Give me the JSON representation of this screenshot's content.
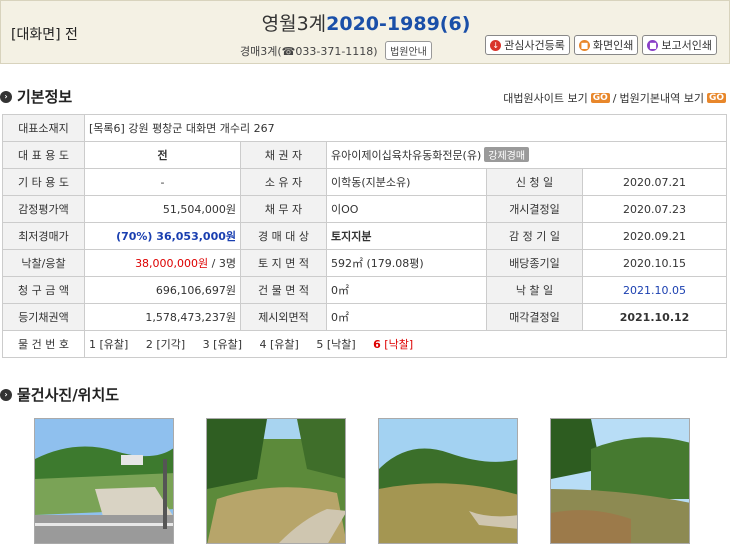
{
  "header": {
    "location": "[대화면] 전",
    "court": "영월3계",
    "case_no": "2020-1989(6)",
    "contact_prefix": "경매3계(☎",
    "phone": "033-371-1118)",
    "court_info_btn": "법원안내",
    "btn_interest": "관심사건등록",
    "btn_print_screen": "화면인쇄",
    "btn_print_report": "보고서인쇄"
  },
  "basic": {
    "title": "기본정보",
    "link_supreme": "대법원사이트 보기",
    "link_court": "법원기본내역 보기",
    "go": "GO",
    "sep": "/"
  },
  "rows": {
    "addr_label": "대표소재지",
    "addr_tag": "[목록6]",
    "addr_value": "강원 평창군 대화면 개수리 267",
    "use_label": "대 표 용 도",
    "use_value": "전",
    "creditor_label": "채 권 자",
    "creditor_value": "유아이제이십육차유동화전문(유)",
    "forced_tag": "강제경매",
    "other_use_label": "기 타 용 도",
    "other_use_value": "-",
    "owner_label": "소 유 자",
    "owner_value": "이학동(지분소유)",
    "apply_label": "신 청 일",
    "apply_value": "2020.07.21",
    "appraisal_label": "감정평가액",
    "appraisal_value": "51,504,000원",
    "debtor_label": "채 무 자",
    "debtor_value": "이OO",
    "start_label": "개시결정일",
    "start_value": "2020.07.23",
    "min_label": "최저경매가",
    "min_value": "(70%) 36,053,000원",
    "target_label": "경 매 대 상",
    "target_value": "토지지분",
    "appraisal_date_label": "감 정 기 일",
    "appraisal_date_value": "2020.09.21",
    "bid_label": "낙찰/응찰",
    "bid_value": "38,000,000원",
    "bid_count": " / 3명",
    "land_label": "토 지 면 적",
    "land_value": "592㎡ (179.08평)",
    "dividend_label": "배당종기일",
    "dividend_value": "2020.10.15",
    "claim_label": "청 구 금 액",
    "claim_value": "696,106,697원",
    "building_label": "건 물 면 적",
    "building_value": "0㎡",
    "winning_label": "낙 찰 일",
    "winning_value": "2021.10.05",
    "registered_label": "등기채권액",
    "registered_value": "1,578,473,237원",
    "excluded_label": "제시외면적",
    "excluded_value": "0㎡",
    "sale_label": "매각결정일",
    "sale_value": "2021.10.12",
    "history_label": "물 건 번 호"
  },
  "history": [
    {
      "num": "1",
      "status": "[유찰]"
    },
    {
      "num": "2",
      "status": "[기각]"
    },
    {
      "num": "3",
      "status": "[유찰]"
    },
    {
      "num": "4",
      "status": "[유찰]"
    },
    {
      "num": "5",
      "status": "[낙찰]"
    },
    {
      "num": "6",
      "status": "[낙찰]"
    }
  ],
  "photos_section": {
    "title": "물건사진/위치도"
  },
  "colors": {
    "accent": "#1a4fa8",
    "go": "#e8872b",
    "header_bg": "#f4f1e4"
  }
}
